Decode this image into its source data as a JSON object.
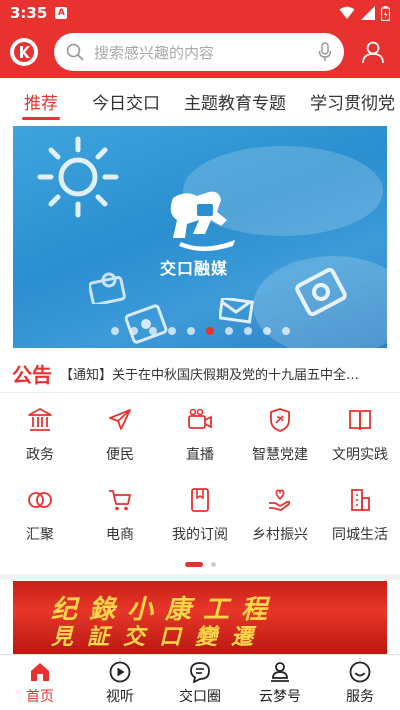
{
  "status_bar": {
    "time": "3:35",
    "badge": "A"
  },
  "header": {
    "search_placeholder": "搜索感兴趣的内容"
  },
  "tabs": [
    {
      "label": "推荐",
      "active": true
    },
    {
      "label": "今日交口",
      "active": false
    },
    {
      "label": "主题教育专题",
      "active": false
    },
    {
      "label": "学习贯彻党",
      "active": false
    }
  ],
  "banner": {
    "brand_text": "交口融媒",
    "slide_count": 10,
    "active_slide_index": 5
  },
  "notice": {
    "label": "公告",
    "text": "【通知】关于在中秋国庆假期及党的十九届五中全会召开期间"
  },
  "services": [
    {
      "label": "政务",
      "icon": "government-building-icon"
    },
    {
      "label": "便民",
      "icon": "paper-plane-icon"
    },
    {
      "label": "直播",
      "icon": "video-camera-icon"
    },
    {
      "label": "智慧党建",
      "icon": "party-emblem-shield-icon"
    },
    {
      "label": "文明实践",
      "icon": "open-book-icon"
    },
    {
      "label": "汇聚",
      "icon": "linked-rings-icon"
    },
    {
      "label": "电商",
      "icon": "shopping-cart-icon"
    },
    {
      "label": "我的订阅",
      "icon": "bookmark-card-icon"
    },
    {
      "label": "乡村振兴",
      "icon": "heart-hand-icon"
    },
    {
      "label": "同城生活",
      "icon": "city-buildings-icon"
    }
  ],
  "promo": {
    "line1": "纪錄小康工程",
    "line2": "見証交口變遷"
  },
  "bottom_nav": [
    {
      "label": "首页",
      "icon": "home-icon",
      "active": true
    },
    {
      "label": "视听",
      "icon": "play-circle-icon",
      "active": false
    },
    {
      "label": "交口圈",
      "icon": "chat-bubble-icon",
      "active": false
    },
    {
      "label": "云梦号",
      "icon": "person-stamp-icon",
      "active": false
    },
    {
      "label": "服务",
      "icon": "smiley-icon",
      "active": false
    }
  ],
  "colors": {
    "brand": "#e8322f",
    "banner_blue": "#2b8fd0",
    "promo_gold": "#ffd84a"
  }
}
